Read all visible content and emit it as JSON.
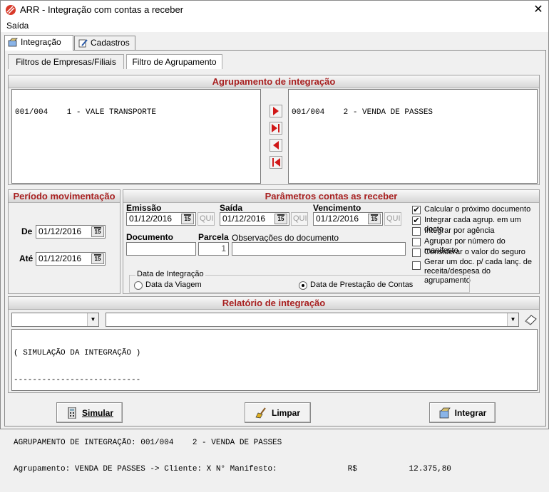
{
  "window": {
    "title": "ARR - Integração com contas a receber"
  },
  "menu": {
    "items": [
      {
        "label": "Saída"
      }
    ]
  },
  "tabs": [
    {
      "label": "Integração"
    },
    {
      "label": "Cadastros"
    }
  ],
  "subtabs": [
    {
      "label": "Filtros de Empresas/Filiais"
    },
    {
      "label": "Filtro de Agrupamento"
    }
  ],
  "agrupamento": {
    "header": "Agrupamento de integração",
    "left_list": [
      "001/004    1 - VALE TRANSPORTE"
    ],
    "right_list": [
      "001/004    2 - VENDA DE PASSES"
    ]
  },
  "periodo": {
    "header": "Período movimentação",
    "de_label": "De",
    "de_value": "01/12/2016",
    "ate_label": "Até",
    "ate_value": "01/12/2016"
  },
  "parametros": {
    "header": "Parâmetros contas as receber",
    "emissao_label": "Emissão",
    "emissao_value": "01/12/2016",
    "emissao_day": "QUI",
    "saida_label": "Saída",
    "saida_value": "01/12/2016",
    "saida_day": "QUI",
    "vencimento_label": "Vencimento",
    "vencimento_value": "01/12/2016",
    "vencimento_day": "QUI",
    "documento_label": "Documento",
    "documento_value": "",
    "parcela_label": "Parcela",
    "parcela_value": "1",
    "observacoes_label": "Observações do documento",
    "observacoes_value": "",
    "checkboxes": [
      {
        "label": "Calcular o próximo documento",
        "checked": true
      },
      {
        "label": "Integrar cada agrup. em um docto",
        "checked": true
      },
      {
        "label": "Integrar por agência",
        "checked": false
      },
      {
        "label": "Agrupar por número do manifesto",
        "checked": false
      },
      {
        "label": "Considerar o valor do seguro",
        "checked": false
      },
      {
        "label": "Gerar um doc. p/ cada lanç. de receita/despesa  do agrupamento",
        "checked": false
      }
    ],
    "data_integracao": {
      "legend": "Data de Integração",
      "option1": "Data da Viagem",
      "option2": "Data de Prestação de Contas",
      "selected": "Data de Prestação de Contas"
    }
  },
  "relatorio": {
    "header": "Relatório de integração",
    "combo1_value": "",
    "combo2_value": "",
    "lines": [
      "( SIMULAÇÃO DA INTEGRAÇÃO )",
      "---------------------------",
      "",
      "AGRUPAMENTO DE INTEGRAÇÃO: 001/004    2 - VENDA DE PASSES",
      "Agrupamento: VENDA DE PASSES -> Cliente: X N° Manifesto:               R$           12.375,80"
    ]
  },
  "buttons": {
    "simular": "Simular",
    "limpar": "Limpar",
    "integrar": "Integrar"
  },
  "calendar_icon_text": "15",
  "colors": {
    "header_text": "#a82020",
    "arrow_red": "#d01818"
  }
}
